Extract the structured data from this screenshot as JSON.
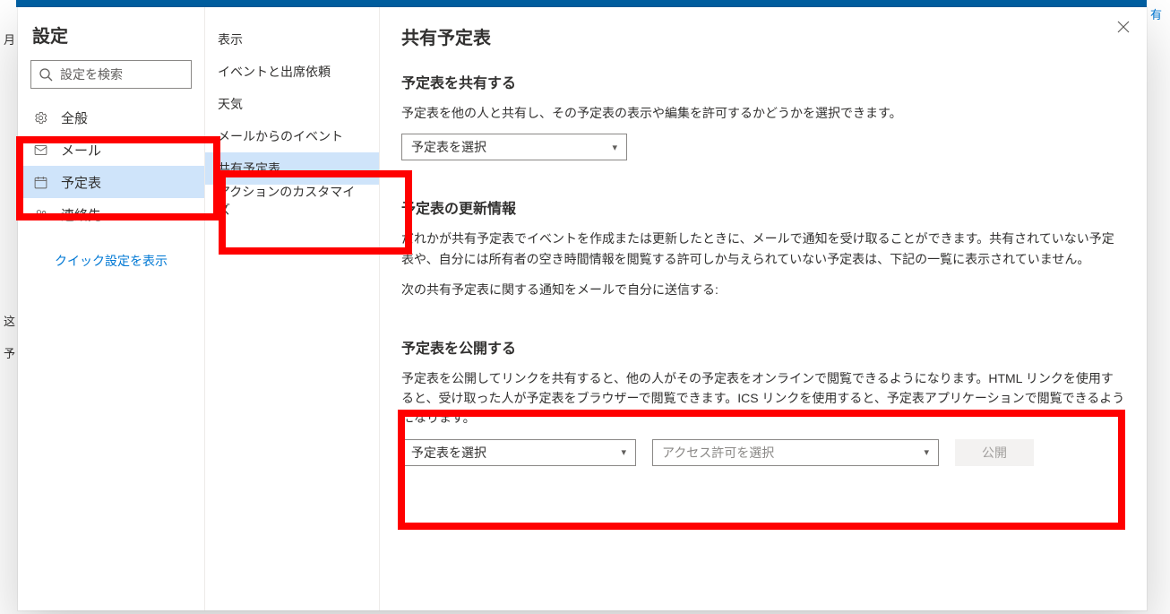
{
  "bg": {
    "left1": "月",
    "left2": "这",
    "left3": "予",
    "right1": "有"
  },
  "settings_title": "設定",
  "search_placeholder": "設定を検索",
  "left_nav": {
    "general": "全般",
    "mail": "メール",
    "calendar": "予定表",
    "people": "連絡先"
  },
  "quick_settings": "クイック設定を表示",
  "mid_nav": {
    "view": "表示",
    "events": "イベントと出席依頼",
    "weather": "天気",
    "events_from_mail": "メールからのイベント",
    "shared": "共有予定表",
    "actions": "アクションのカスタマイズ"
  },
  "main": {
    "heading": "共有予定表",
    "share": {
      "title": "予定表を共有する",
      "desc": "予定表を他の人と共有し、その予定表の表示や編集を許可するかどうかを選択できます。",
      "dropdown": "予定表を選択"
    },
    "updates": {
      "title": "予定表の更新情報",
      "desc": "だれかが共有予定表でイベントを作成または更新したときに、メールで通知を受け取ることができます。共有されていない予定表や、自分には所有者の空き時間情報を閲覧する許可しか与えられていない予定表は、下記の一覧に表示されていません。",
      "line2": "次の共有予定表に関する通知をメールで自分に送信する:"
    },
    "publish": {
      "title": "予定表を公開する",
      "desc": "予定表を公開してリンクを共有すると、他の人がその予定表をオンラインで閲覧できるようになります。HTML リンクを使用すると、受け取った人が予定表をブラウザーで閲覧できます。ICS リンクを使用すると、予定表アプリケーションで閲覧できるようになります。",
      "dropdown1": "予定表を選択",
      "dropdown2": "アクセス許可を選択",
      "button": "公開"
    }
  }
}
